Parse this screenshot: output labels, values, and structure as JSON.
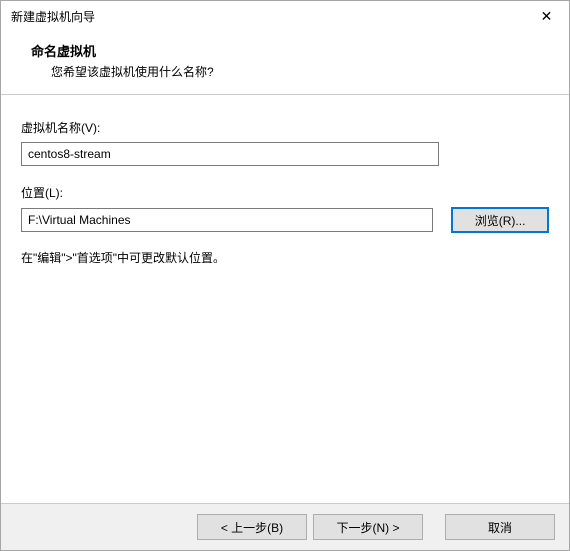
{
  "titlebar": {
    "title": "新建虚拟机向导",
    "close_icon": "✕"
  },
  "header": {
    "title": "命名虚拟机",
    "subtitle": "您希望该虚拟机使用什么名称?"
  },
  "fields": {
    "vm_name_label": "虚拟机名称(V):",
    "vm_name_value": "centos8-stream",
    "location_label": "位置(L):",
    "location_value": "F:\\Virtual Machines",
    "browse_label": "浏览(R)...",
    "hint": "在\"编辑\">\"首选项\"中可更改默认位置。"
  },
  "footer": {
    "back_label": "< 上一步(B)",
    "next_label": "下一步(N) >",
    "cancel_label": "取消"
  }
}
